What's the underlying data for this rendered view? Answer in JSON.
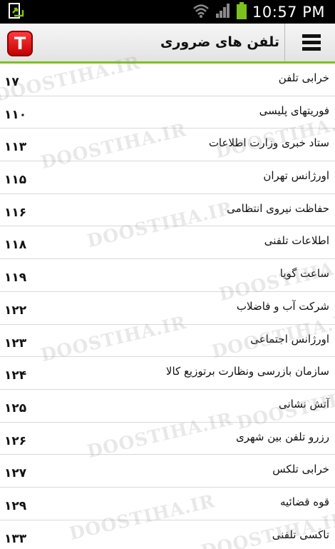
{
  "status_bar": {
    "time": "10:57 PM",
    "icons": [
      "download-notification-icon",
      "wifi-icon",
      "signal-icon",
      "battery-icon"
    ]
  },
  "header": {
    "title": "تلفن های ضروری",
    "logo_letter": "T",
    "accent_color": "#7cc21e",
    "logo_color": "#e00000"
  },
  "watermark": "DOOSTIHA.IR",
  "items": [
    {
      "name": "خرابی تلفن",
      "number": "۱۷"
    },
    {
      "name": "فوریتهای پلیسی",
      "number": "۱۱۰"
    },
    {
      "name": "ستاد خبری وزارت اطلاعات",
      "number": "۱۱۳"
    },
    {
      "name": "اورژانس تهران",
      "number": "۱۱۵"
    },
    {
      "name": "حفاظت نیروی انتظامی",
      "number": "۱۱۶"
    },
    {
      "name": "اطلاعات تلفنی",
      "number": "۱۱۸"
    },
    {
      "name": "ساعت گویا",
      "number": "۱۱۹"
    },
    {
      "name": "شرکت آب و فاضلاب",
      "number": "۱۲۲"
    },
    {
      "name": "اورژانس اجتماعی",
      "number": "۱۲۳"
    },
    {
      "name": "سازمان بازرسی ونظارت برتوزیع کالا",
      "number": "۱۲۴"
    },
    {
      "name": "آتش نشانی",
      "number": "۱۲۵"
    },
    {
      "name": "رزرو تلفن بین شهری",
      "number": "۱۲۶"
    },
    {
      "name": "خرابی تلکس",
      "number": "۱۲۷"
    },
    {
      "name": "قوه قضائیه",
      "number": "۱۲۹"
    },
    {
      "name": "تاکسی تلفنی",
      "number": "۱۳۳"
    }
  ]
}
